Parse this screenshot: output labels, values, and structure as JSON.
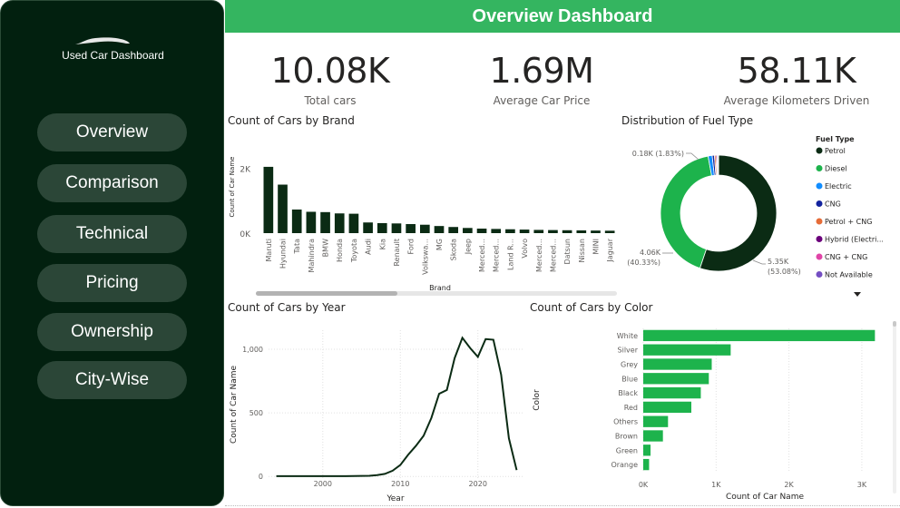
{
  "sidebar": {
    "app_title": "Used Car Dashboard",
    "nav": [
      "Overview",
      "Comparison",
      "Technical",
      "Pricing",
      "Ownership",
      "City-Wise"
    ]
  },
  "header": {
    "title": "Overview Dashboard"
  },
  "kpis": [
    {
      "value": "10.08K",
      "label": "Total cars"
    },
    {
      "value": "1.69M",
      "label": "Average Car Price"
    },
    {
      "value": "58.11K",
      "label": "Average Kilometers Driven"
    }
  ],
  "colors": {
    "dark_green": "#0b2b14",
    "green": "#1db34c",
    "header_green": "#34b560",
    "sidebar": "#02200f",
    "nav_button": "#2b4637"
  },
  "chart_data": [
    {
      "type": "bar",
      "title": "Count of Cars by Brand",
      "xlabel": "Brand",
      "ylabel": "Count of Car Name",
      "yticks": [
        "0K",
        "2K"
      ],
      "ylim": [
        0,
        2300
      ],
      "categories": [
        "Maruti",
        "Hyundai",
        "Tata",
        "Mahindra",
        "BMW",
        "Honda",
        "Toyota",
        "Audi",
        "Kia",
        "Renault",
        "Ford",
        "Volkswa...",
        "MG",
        "Skoda",
        "Jeep",
        "Merced...",
        "Merced...",
        "Land R...",
        "Volvo",
        "Merced...",
        "Merced...",
        "Datsun",
        "Nissan",
        "MINI",
        "Jaguar"
      ],
      "values": [
        2050,
        1500,
        730,
        660,
        650,
        610,
        600,
        330,
        310,
        300,
        280,
        260,
        220,
        190,
        160,
        140,
        130,
        120,
        110,
        100,
        95,
        90,
        85,
        80,
        75
      ],
      "color": "#0b2b14"
    },
    {
      "type": "pie",
      "title": "Distribution of Fuel Type",
      "legend_title": "Fuel Type",
      "legend_position": "right",
      "labels": [
        "Petrol",
        "Diesel",
        "Electric",
        "CNG",
        "Petrol + CNG",
        "Hybrid (Electri...",
        "CNG + CNG",
        "Not Available"
      ],
      "values": [
        5350,
        4060,
        110,
        60,
        40,
        30,
        25,
        15
      ],
      "colors": [
        "#0b2b14",
        "#1db34c",
        "#118dff",
        "#12239e",
        "#e66c37",
        "#6b007b",
        "#e044a7",
        "#744ec2"
      ],
      "data_labels": [
        "5.35K",
        "(53.08%)",
        "4.06K",
        "(40.33%)",
        "0.18K (1.83%)"
      ]
    },
    {
      "type": "line",
      "title": "Count of Cars by Year",
      "xlabel": "Year",
      "ylabel": "Count of Car Name",
      "xticks": [
        2000,
        2010,
        2020
      ],
      "yticks": [
        "0",
        "500",
        "1,000"
      ],
      "xlim": [
        1993,
        2026
      ],
      "ylim": [
        -20,
        1150
      ],
      "x": [
        1994,
        1996,
        1998,
        2000,
        2002,
        2004,
        2006,
        2007,
        2008,
        2009,
        2010,
        2011,
        2012,
        2013,
        2014,
        2015,
        2016,
        2017,
        2018,
        2019,
        2020,
        2021,
        2022,
        2023,
        2024,
        2025
      ],
      "y": [
        2,
        2,
        2,
        2,
        2,
        3,
        5,
        10,
        20,
        45,
        90,
        170,
        240,
        320,
        460,
        650,
        680,
        930,
        1090,
        1010,
        940,
        1080,
        1075,
        800,
        300,
        50
      ],
      "color": "#0b2b14"
    },
    {
      "type": "bar",
      "orientation": "horizontal",
      "title": "Count of Cars by Color",
      "xlabel": "Count of Car Name",
      "ylabel": "Color",
      "xticks": [
        "0K",
        "1K",
        "2K",
        "3K"
      ],
      "xlim": [
        0,
        3300
      ],
      "categories": [
        "White",
        "Silver",
        "Grey",
        "Blue",
        "Black",
        "Red",
        "Others",
        "Brown",
        "Green",
        "Orange"
      ],
      "values": [
        3180,
        1200,
        940,
        900,
        790,
        660,
        340,
        270,
        100,
        80
      ],
      "color": "#1db34c"
    }
  ]
}
